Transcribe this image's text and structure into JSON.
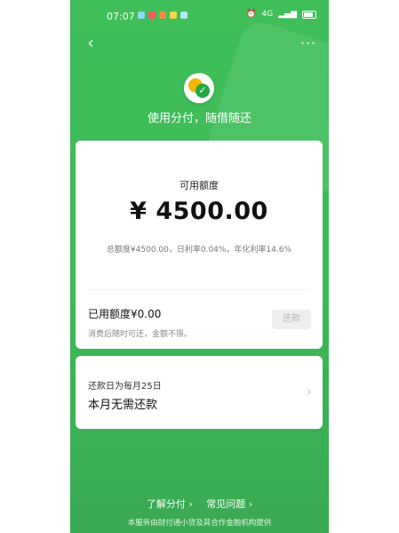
{
  "status_bar": {
    "time": "07:07",
    "notif_colors": [
      "#8fd9ff",
      "#ff5a5a",
      "#ff8a3d",
      "#ffd84a",
      "#b5e8ff"
    ],
    "right_text": "4G"
  },
  "nav": {
    "back_icon": "chevron-left-icon",
    "more_icon": "more-dots-icon",
    "more_glyph": "···",
    "back_glyph": "‹"
  },
  "header": {
    "slogan": "使用分付，随借随还"
  },
  "credit": {
    "available_label": "可用额度",
    "available_amount": "¥ 4500.00",
    "quota_note": "总额度¥4500.00，日利率0.04%，年化利率14.6%"
  },
  "used": {
    "label": "已用额度¥0.00",
    "desc": "消费后随时可还，金额不限。",
    "repay_button": "还款"
  },
  "repayment": {
    "date_label": "还款日为每月25日",
    "status": "本月无需还款",
    "chevron": "›"
  },
  "footer": {
    "learn_link": "了解分付",
    "faq_link": "常见问题",
    "link_chevron": "›",
    "note": "本服务由财付通小贷及其合作金融机构提供"
  },
  "colors": {
    "brand_green": "#3fbe5a",
    "accent_green": "#23a843",
    "coin_yellow": "#f2b705"
  }
}
